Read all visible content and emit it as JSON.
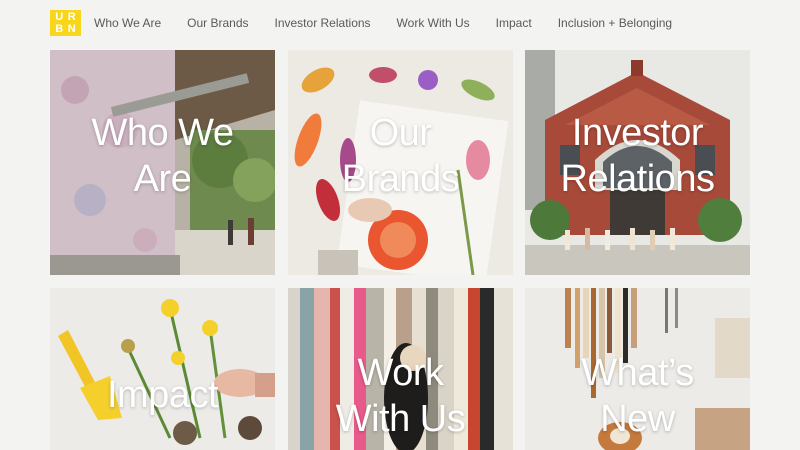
{
  "logo": {
    "letters": [
      "U",
      "R",
      "B",
      "N"
    ],
    "color": "#f7d61b"
  },
  "nav": [
    {
      "label": "Who We Are"
    },
    {
      "label": "Our Brands"
    },
    {
      "label": "Investor Relations"
    },
    {
      "label": "Work With Us"
    },
    {
      "label": "Impact"
    },
    {
      "label": "Inclusion + Belonging"
    }
  ],
  "tiles": [
    {
      "lines": [
        "Who We",
        "Are"
      ]
    },
    {
      "lines": [
        "Our",
        "Brands"
      ]
    },
    {
      "lines": [
        "Investor",
        "Relations"
      ]
    },
    {
      "lines": [
        "Impact"
      ]
    },
    {
      "lines": [
        "Work",
        "With Us"
      ]
    },
    {
      "lines": [
        "What’s",
        "New"
      ]
    }
  ]
}
